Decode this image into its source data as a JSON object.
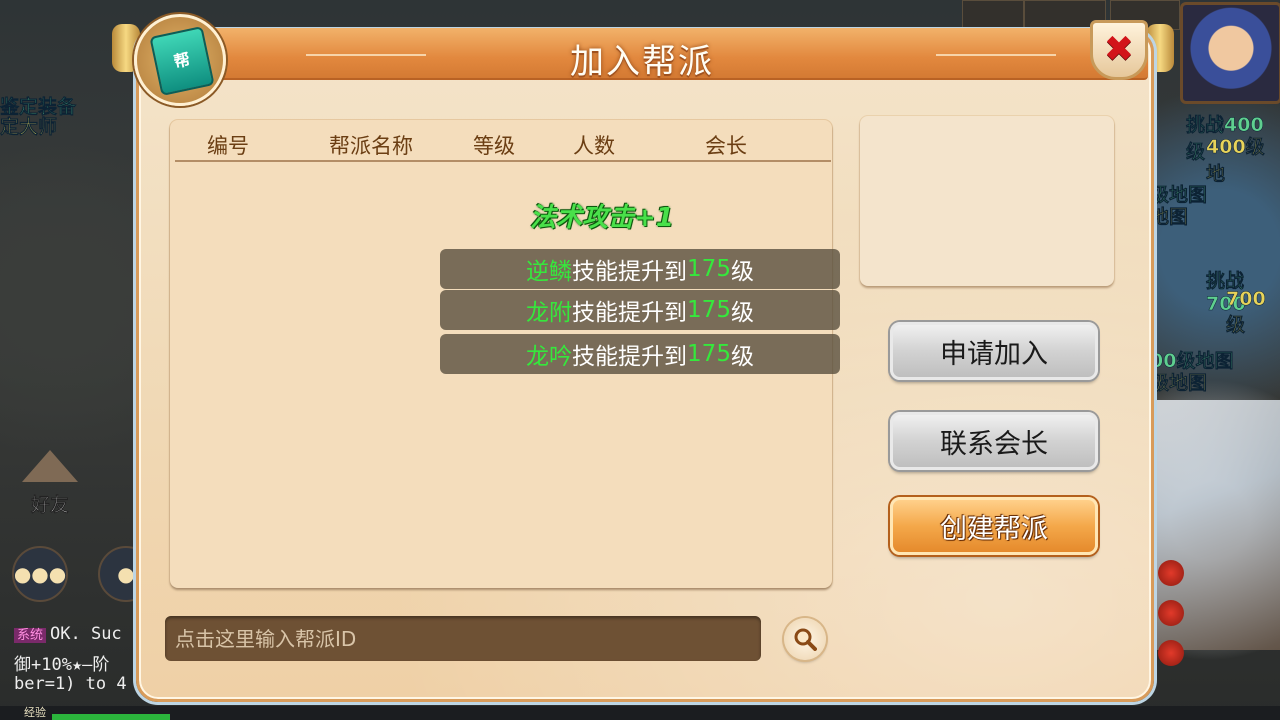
{
  "dialog": {
    "title": "加入帮派",
    "emblem_char": "帮",
    "close_icon": "close-icon"
  },
  "table": {
    "columns": [
      "编号",
      "帮派名称",
      "等级",
      "人数",
      "会长"
    ],
    "rows": []
  },
  "tooltip": {
    "bonus": "法术攻击+1",
    "skills": [
      {
        "name": "逆鳞",
        "text": "技能提升到",
        "level": "175",
        "unit": "级"
      },
      {
        "name": "龙附",
        "text": "技能提升到",
        "level": "175",
        "unit": "级"
      },
      {
        "name": "龙吟",
        "text": "技能提升到",
        "level": "175",
        "unit": "级"
      }
    ]
  },
  "actions": {
    "apply": "申请加入",
    "contact": "联系会长",
    "create": "创建帮派"
  },
  "search": {
    "placeholder": "点击这里输入帮派ID",
    "value": ""
  },
  "background": {
    "left_texts": [
      "鉴定装备",
      "定大师"
    ],
    "right_texts": [
      "挑战400级",
      "400级地",
      "级地图",
      "地图",
      "挑战700",
      "700级",
      "00级地图",
      "级地图"
    ],
    "friend_label": "好友",
    "chat": {
      "system_tag": "系统",
      "line1": "OK. Suc",
      "line2": "御+10%★—阶",
      "line3": "ber=1) to 4"
    },
    "exp_label": "经验",
    "colors": {
      "accent_green": "#35e83c",
      "title_orange": "#e2883e"
    }
  }
}
